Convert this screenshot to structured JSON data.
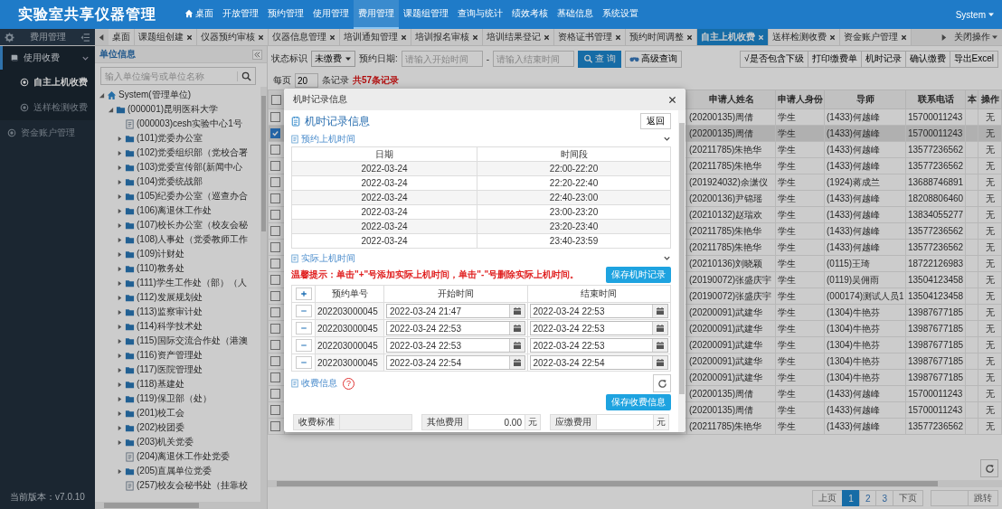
{
  "header": {
    "title": "实验室共享仪器管理",
    "nav": [
      {
        "label": "桌面",
        "selected": false
      },
      {
        "label": "开放管理",
        "selected": false
      },
      {
        "label": "预约管理",
        "selected": false
      },
      {
        "label": "使用管理",
        "selected": false
      },
      {
        "label": "费用管理",
        "selected": true
      },
      {
        "label": "课题组管理",
        "selected": false
      },
      {
        "label": "查询与统计",
        "selected": false
      },
      {
        "label": "绩效考核",
        "selected": false
      },
      {
        "label": "基础信息",
        "selected": false
      },
      {
        "label": "系统设置",
        "selected": false
      }
    ],
    "user": "System"
  },
  "tab_bar": {
    "section_title": "费用管理",
    "tabs": [
      {
        "label": "桌面",
        "closable": false,
        "selected": false
      },
      {
        "label": "课题组创建",
        "closable": true,
        "selected": false
      },
      {
        "label": "仪器预约审核",
        "closable": true,
        "selected": false
      },
      {
        "label": "仪器信息管理",
        "closable": true,
        "selected": false
      },
      {
        "label": "培训通知管理",
        "closable": true,
        "selected": false
      },
      {
        "label": "培训报名审核",
        "closable": true,
        "selected": false
      },
      {
        "label": "培训结果登记",
        "closable": true,
        "selected": false
      },
      {
        "label": "资格证书管理",
        "closable": true,
        "selected": false
      },
      {
        "label": "预约时间调整",
        "closable": true,
        "selected": false
      },
      {
        "label": "自主上机收费",
        "closable": true,
        "selected": true
      },
      {
        "label": "送样检测收费",
        "closable": true,
        "selected": false
      },
      {
        "label": "资金账户管理",
        "closable": true,
        "selected": false
      }
    ],
    "close_menu": "关闭操作"
  },
  "sidebar": {
    "menu": [
      {
        "kind": "group",
        "label": "使用收费",
        "expanded": true,
        "children": [
          {
            "label": "自主上机收费",
            "selected": true
          },
          {
            "label": "送样检测收费",
            "selected": false
          }
        ]
      },
      {
        "kind": "item",
        "label": "资金账户管理",
        "selected": false
      }
    ],
    "version": "当前版本：v7.0.10"
  },
  "unit_panel": {
    "title": "单位信息",
    "search_placeholder": "输入单位编号或单位名称",
    "tree": [
      {
        "label": "System(管理单位)",
        "kind": "root",
        "expanded": true,
        "children": [
          {
            "label": "(000001)昆明医科大学",
            "kind": "folder",
            "expanded": true,
            "children": [
              {
                "label": "(000003)cesh实验中心1号",
                "kind": "document"
              },
              {
                "label": "(101)党委办公室",
                "kind": "folder",
                "expanded": false
              },
              {
                "label": "(102)党委组织部（党校合署",
                "kind": "folder",
                "expanded": false
              },
              {
                "label": "(103)党委宣传部(新闻中心",
                "kind": "folder",
                "expanded": false
              },
              {
                "label": "(104)党委统战部",
                "kind": "folder",
                "expanded": false
              },
              {
                "label": "(105)纪委办公室（巡查办合",
                "kind": "folder",
                "expanded": false
              },
              {
                "label": "(106)离退休工作处",
                "kind": "folder",
                "expanded": false
              },
              {
                "label": "(107)校长办公室（校友会秘",
                "kind": "folder",
                "expanded": false
              },
              {
                "label": "(108)人事处（党委教师工作",
                "kind": "folder",
                "expanded": false
              },
              {
                "label": "(109)计财处",
                "kind": "folder",
                "expanded": false
              },
              {
                "label": "(110)教务处",
                "kind": "folder",
                "expanded": false
              },
              {
                "label": "(111)学生工作处（部）（人",
                "kind": "folder",
                "expanded": false
              },
              {
                "label": "(112)发展规划处",
                "kind": "folder",
                "expanded": false
              },
              {
                "label": "(113)监察审计处",
                "kind": "folder",
                "expanded": false
              },
              {
                "label": "(114)科学技术处",
                "kind": "folder",
                "expanded": false
              },
              {
                "label": "(115)国际交流合作处（港澳",
                "kind": "folder",
                "expanded": false
              },
              {
                "label": "(116)资产管理处",
                "kind": "folder",
                "expanded": false
              },
              {
                "label": "(117)医院管理处",
                "kind": "folder",
                "expanded": false
              },
              {
                "label": "(118)基建处",
                "kind": "folder",
                "expanded": false
              },
              {
                "label": "(119)保卫部（处）",
                "kind": "folder",
                "expanded": false
              },
              {
                "label": "(201)校工会",
                "kind": "folder",
                "expanded": false
              },
              {
                "label": "(202)校团委",
                "kind": "folder",
                "expanded": false
              },
              {
                "label": "(203)机关党委",
                "kind": "folder",
                "expanded": false
              },
              {
                "label": "(204)离退休工作处党委",
                "kind": "document"
              },
              {
                "label": "(205)直属单位党委",
                "kind": "folder",
                "expanded": false
              },
              {
                "label": "(257)校友会秘书处（挂靠校",
                "kind": "document"
              }
            ]
          }
        ]
      }
    ]
  },
  "toolbar": {
    "status_label": "状态标识",
    "status_value": "未缴费",
    "date_label": "预约日期:",
    "start_placeholder": "请输入开始时间",
    "separator": "-",
    "end_placeholder": "请输入结束时间",
    "search_button": "查 询",
    "advanced_button": "高级查询",
    "actions": [
      "√是否包含下级",
      "打印缴费单",
      "机时记录",
      "确认缴费",
      "导出Excel"
    ]
  },
  "paging": {
    "per_page_label": "每页",
    "per_page": "20",
    "records_label": "条记录",
    "total": "共57条记录"
  },
  "table": {
    "all_selected": false,
    "columns": [
      "申请人姓名",
      "申请人身份",
      "导师",
      "联系电话",
      "本",
      "操作"
    ],
    "rows": [
      {
        "selected": false,
        "applicant": "(20200135)周倩",
        "identity": "学生",
        "tutor": "(1433)何越峰",
        "phone": "15700011243",
        "action": "无"
      },
      {
        "selected": true,
        "applicant": "(20200135)周倩",
        "identity": "学生",
        "tutor": "(1433)何越峰",
        "phone": "15700011243",
        "action": "无"
      },
      {
        "selected": false,
        "applicant": "(20211785)朱艳华",
        "identity": "学生",
        "tutor": "(1433)何越峰",
        "phone": "13577236562",
        "action": "无"
      },
      {
        "selected": false,
        "applicant": "(20211785)朱艳华",
        "identity": "学生",
        "tutor": "(1433)何越峰",
        "phone": "13577236562",
        "action": "无"
      },
      {
        "selected": false,
        "applicant": "(201924032)余潇仪",
        "identity": "学生",
        "tutor": "(1924)蒋成兰",
        "phone": "13688746891",
        "action": "无"
      },
      {
        "selected": false,
        "applicant": "(20200136)尹锦瑶",
        "identity": "学生",
        "tutor": "(1433)何越峰",
        "phone": "18208806460",
        "action": "无"
      },
      {
        "selected": false,
        "applicant": "(20210132)赵瑞欢",
        "identity": "学生",
        "tutor": "(1433)何越峰",
        "phone": "13834055277",
        "action": "无"
      },
      {
        "selected": false,
        "applicant": "(20211785)朱艳华",
        "identity": "学生",
        "tutor": "(1433)何越峰",
        "phone": "13577236562",
        "action": "无"
      },
      {
        "selected": false,
        "applicant": "(20211785)朱艳华",
        "identity": "学生",
        "tutor": "(1433)何越峰",
        "phone": "13577236562",
        "action": "无"
      },
      {
        "selected": false,
        "applicant": "(20210136)刘晓颖",
        "identity": "学生",
        "tutor": "(0115)王琦",
        "phone": "18722126983",
        "action": "无"
      },
      {
        "selected": false,
        "applicant": "(20190072)张盛庆宇",
        "identity": "学生",
        "tutor": "(0119)吴佣雨",
        "phone": "13504123458",
        "action": "无"
      },
      {
        "selected": false,
        "applicant": "(20190072)张盛庆宇",
        "identity": "学生",
        "tutor": "(000174)测试人员1",
        "phone": "13504123458",
        "action": "无"
      },
      {
        "selected": false,
        "applicant": "(20200091)武建华",
        "identity": "学生",
        "tutor": "(1304)牛艳芬",
        "phone": "13987677185",
        "action": "无"
      },
      {
        "selected": false,
        "applicant": "(20200091)武建华",
        "identity": "学生",
        "tutor": "(1304)牛艳芬",
        "phone": "13987677185",
        "action": "无"
      },
      {
        "selected": false,
        "applicant": "(20200091)武建华",
        "identity": "学生",
        "tutor": "(1304)牛艳芬",
        "phone": "13987677185",
        "action": "无"
      },
      {
        "selected": false,
        "applicant": "(20200091)武建华",
        "identity": "学生",
        "tutor": "(1304)牛艳芬",
        "phone": "13987677185",
        "action": "无"
      },
      {
        "selected": false,
        "applicant": "(20200091)武建华",
        "identity": "学生",
        "tutor": "(1304)牛艳芬",
        "phone": "13987677185",
        "action": "无"
      },
      {
        "selected": false,
        "applicant": "(20200135)周倩",
        "identity": "学生",
        "tutor": "(1433)何越峰",
        "phone": "15700011243",
        "action": "无"
      },
      {
        "selected": false,
        "applicant": "(20200135)周倩",
        "identity": "学生",
        "tutor": "(1433)何越峰",
        "phone": "15700011243",
        "action": "无"
      },
      {
        "selected": false,
        "applicant": "(20211785)朱艳华",
        "identity": "学生",
        "tutor": "(1433)何越峰",
        "phone": "13577236562",
        "action": "无"
      }
    ]
  },
  "pagination": {
    "prev": "上页",
    "pages": [
      {
        "label": "1",
        "selected": true
      },
      {
        "label": "2",
        "selected": false
      },
      {
        "label": "3",
        "selected": false
      }
    ],
    "next": "下页",
    "jump": "跳转"
  },
  "modal": {
    "title": "机时记录信息",
    "heading": "机时记录信息",
    "back_button": "返回",
    "reserved": {
      "title": "预约上机时间",
      "expanded": true,
      "columns": [
        "日期",
        "时间段"
      ],
      "rows": [
        [
          "2022-03-24",
          "22:00-22:20"
        ],
        [
          "2022-03-24",
          "22:20-22:40"
        ],
        [
          "2022-03-24",
          "22:40-23:00"
        ],
        [
          "2022-03-24",
          "23:00-23:20"
        ],
        [
          "2022-03-24",
          "23:20-23:40"
        ],
        [
          "2022-03-24",
          "23:40-23:59"
        ]
      ]
    },
    "actual": {
      "title": "实际上机时间",
      "expanded": true,
      "hint": "温馨提示：单击\"+\"号添加实际上机时间，单击\"-\"号删除实际上机时间。",
      "save_button": "保存机时记录",
      "columns": [
        "预约单号",
        "开始时间",
        "结束时间"
      ],
      "rows": [
        {
          "order": "202203000045",
          "start": "2022-03-24 21:47",
          "end": "2022-03-24 22:53"
        },
        {
          "order": "202203000045",
          "start": "2022-03-24 22:53",
          "end": "2022-03-24 22:53"
        },
        {
          "order": "202203000045",
          "start": "2022-03-24 22:53",
          "end": "2022-03-24 22:53"
        },
        {
          "order": "202203000045",
          "start": "2022-03-24 22:54",
          "end": "2022-03-24 22:54"
        }
      ]
    },
    "fees": {
      "title": "收费信息",
      "help_mark": "?",
      "save_button": "保存收费信息",
      "fields": [
        {
          "label": "收费标准",
          "disabled": true
        },
        {
          "label": "其他费用",
          "value": "0.00",
          "unit": "元",
          "disabled": false
        },
        {
          "label": "应缴费用",
          "unit": "元",
          "disabled": false
        }
      ]
    }
  }
}
